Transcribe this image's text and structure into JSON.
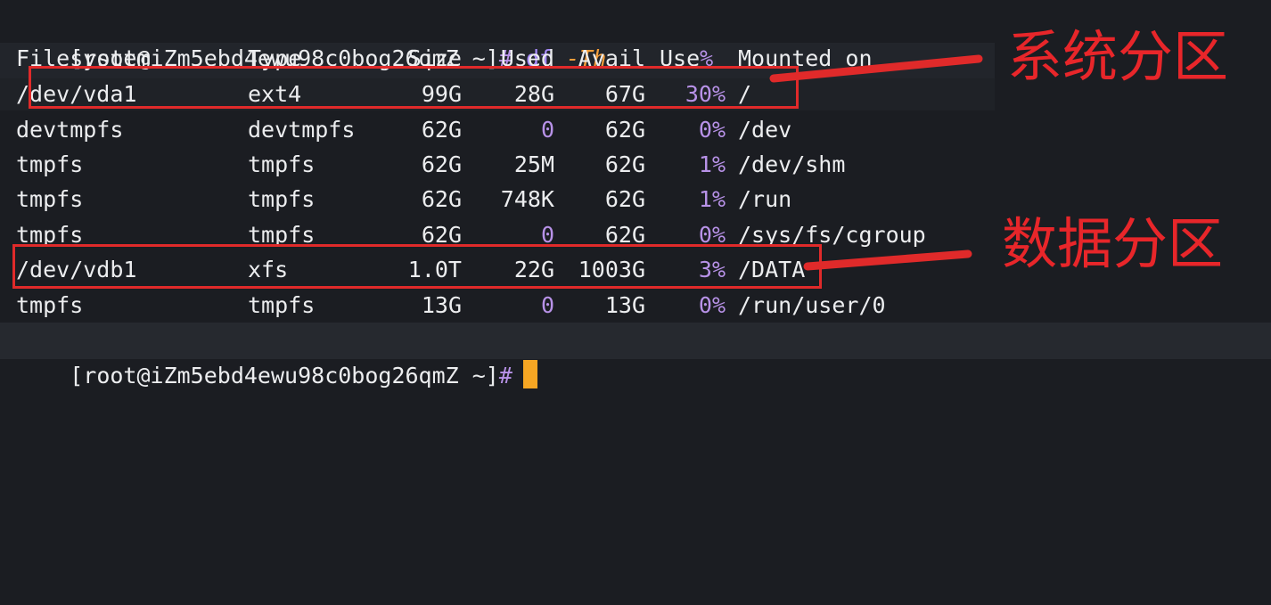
{
  "prompt": {
    "user_host": "[root@iZm5ebd4ewu98c0bog26qmZ ~]",
    "hash": "#"
  },
  "command": {
    "name": "df",
    "flag": "-Th"
  },
  "header": {
    "filesystem": "Filesystem",
    "type": "Type",
    "size": "Size",
    "used": "Used",
    "avail": "Avail",
    "use": "Use",
    "use_pct_sign": "%",
    "mounted": "Mounted on"
  },
  "rows": [
    {
      "filesystem": "/dev/vda1",
      "type": "ext4",
      "size": "99G",
      "used": "28G",
      "avail": "67G",
      "use": "30%",
      "mounted": "/"
    },
    {
      "filesystem": "devtmpfs",
      "type": "devtmpfs",
      "size": "62G",
      "used": "0",
      "avail": "62G",
      "use": "0%",
      "mounted": "/dev"
    },
    {
      "filesystem": "tmpfs",
      "type": "tmpfs",
      "size": "62G",
      "used": "25M",
      "avail": "62G",
      "use": "1%",
      "mounted": "/dev/shm"
    },
    {
      "filesystem": "tmpfs",
      "type": "tmpfs",
      "size": "62G",
      "used": "748K",
      "avail": "62G",
      "use": "1%",
      "mounted": "/run"
    },
    {
      "filesystem": "tmpfs",
      "type": "tmpfs",
      "size": "62G",
      "used": "0",
      "avail": "62G",
      "use": "0%",
      "mounted": "/sys/fs/cgroup"
    },
    {
      "filesystem": "/dev/vdb1",
      "type": "xfs",
      "size": "1.0T",
      "used": "22G",
      "avail": "1003G",
      "use": "3%",
      "mounted": "/DATA"
    },
    {
      "filesystem": "tmpfs",
      "type": "tmpfs",
      "size": "13G",
      "used": "0",
      "avail": "13G",
      "use": "0%",
      "mounted": "/run/user/0"
    }
  ],
  "annotations": {
    "system_partition": "系统分区",
    "data_partition": "数据分区"
  },
  "colors": {
    "background": "#1b1d22",
    "text": "#ecedef",
    "purple": "#b892e8",
    "orange_flag": "#f59e3a",
    "cursor": "#f6a623",
    "annotation_red": "#e8262a"
  }
}
